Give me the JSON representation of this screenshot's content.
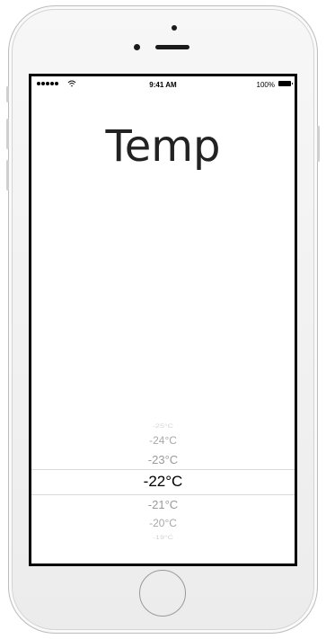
{
  "status_bar": {
    "time": "9:41 AM",
    "battery": "100%"
  },
  "app": {
    "title": "Temp"
  },
  "picker": {
    "rows": [
      "-25°C",
      "-24°C",
      "-23°C",
      "-22°C",
      "-21°C",
      "-20°C",
      "-19°C"
    ],
    "selected": "-22°C"
  },
  "icons": {
    "signal": "signal-dots-icon",
    "wifi": "wifi-icon",
    "battery": "battery-icon"
  }
}
